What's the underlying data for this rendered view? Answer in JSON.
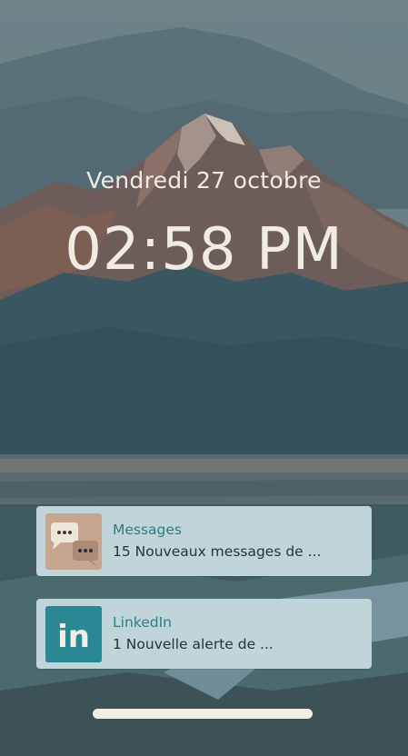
{
  "lockscreen": {
    "date": "Vendredi 27 octobre",
    "time": "02:58 PM"
  },
  "notifications": [
    {
      "app": "Messages",
      "text": "15 Nouveaux messages de ...",
      "icon": "messages-icon"
    },
    {
      "app": "LinkedIn",
      "text": "1 Nouvelle alerte de ...",
      "icon": "linkedin-icon",
      "icon_text": "in"
    }
  ],
  "colors": {
    "sky": "#6a8187",
    "mountain_dark": "#34505b",
    "notification_bg": "#bfd5da",
    "app_name": "#2f7c84",
    "linkedin_brand": "#2a8794",
    "text_light": "#f1ece3"
  }
}
